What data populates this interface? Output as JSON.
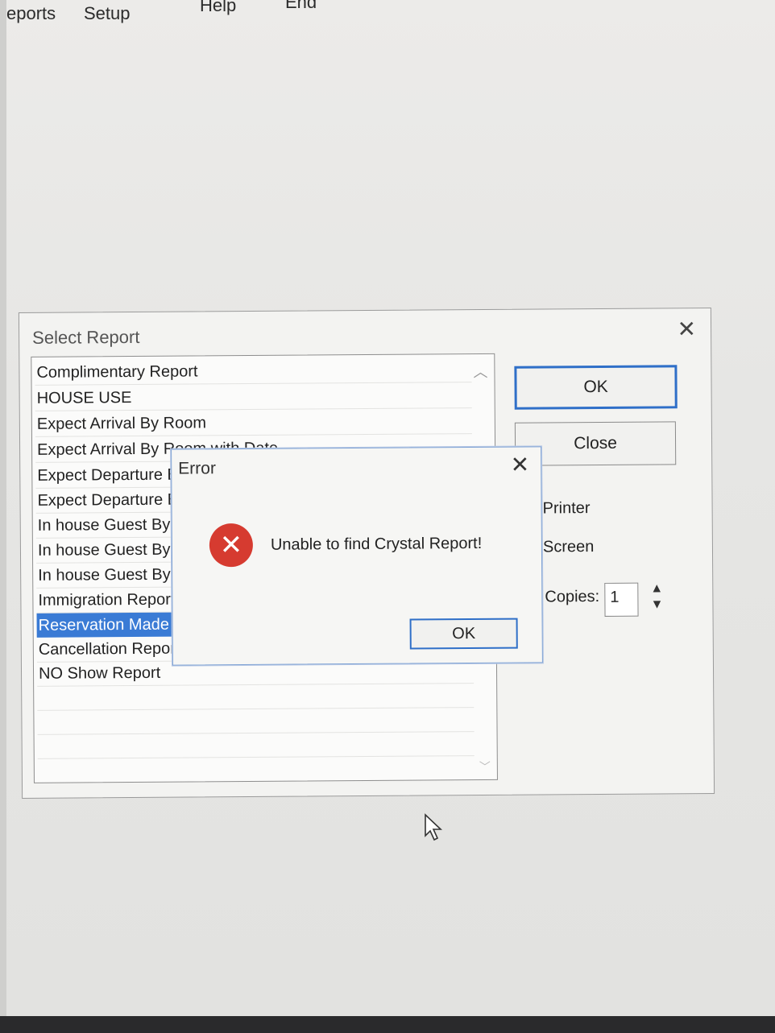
{
  "menubar": {
    "items": [
      "eports",
      "Setup",
      "Help",
      "End"
    ]
  },
  "select_report": {
    "title": "Select Report",
    "close_icon": "close-icon",
    "items": [
      "Complimentary Report",
      "HOUSE USE",
      "Expect Arrival By Room",
      "Expect Arrival By Room with Date",
      "Expect Departure By Room",
      "Expect Departure By Room with Date",
      "In house Guest By Room",
      "In house Guest By Name",
      "In house Guest By Date",
      "Immigration Report",
      "Reservation Made",
      "Cancellation Report",
      "NO Show Report"
    ],
    "selected_index": 10,
    "ok_label": "OK",
    "close_label": "Close",
    "printer_label": "Printer",
    "screen_label": "Screen",
    "copies_label": "Copies:",
    "copies_value": "1"
  },
  "error_dialog": {
    "title": "Error",
    "message": "Unable to find Crystal Report!",
    "ok_label": "OK",
    "icon": "error-icon"
  },
  "colors": {
    "selection": "#3a7bd5",
    "default_button_border": "#2f6fc8",
    "error_red": "#d63b30"
  }
}
